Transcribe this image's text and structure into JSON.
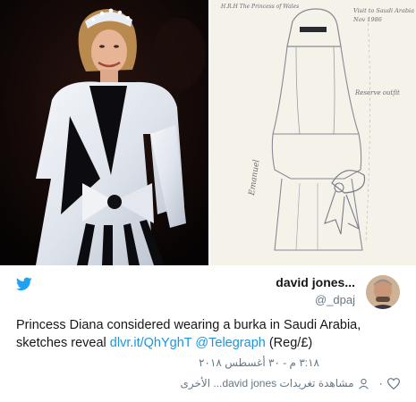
{
  "tweet": {
    "author_name": "david jones...",
    "author_handle": "@_dpaj",
    "text_plain": "Princess Diana considered wearing a burka in Saudi Arabia, sketches reveal ",
    "link": "dlvr.it/QhYghT",
    "mention": "@Telegraph",
    "text_tail": " (Reg/£)",
    "date": "٣:١٨ م - ٣٠ أغسطس ٢٠١٨",
    "like_count": "٠",
    "others_text": "مشاهدة تغريدات david jones... الأخرى"
  },
  "sketch_notes": {
    "top_left": "H.R.H The Princess of Wales",
    "top_right_1": "Visit to Saudi Arabia",
    "top_right_2": "Nov 1986",
    "side_note": "Reserve outfit",
    "signature": "Emanuel"
  },
  "icons": {
    "brand": "twitter-bird-icon",
    "like": "heart-icon",
    "profile": "person-icon"
  },
  "colors": {
    "accent": "#1da1f2",
    "link": "#1b95e0",
    "muted": "#657786",
    "text": "#14171a"
  }
}
